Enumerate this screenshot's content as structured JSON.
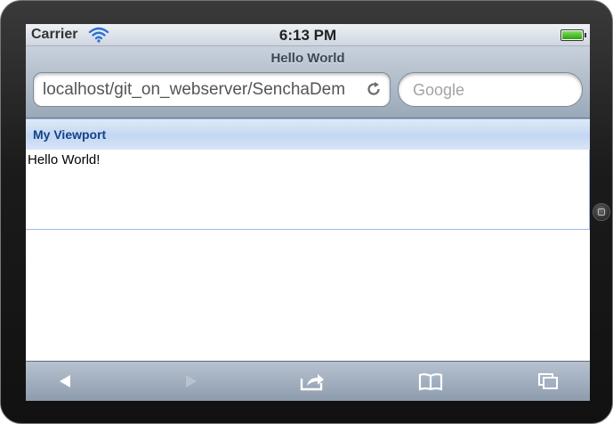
{
  "status_bar": {
    "carrier": "Carrier",
    "time": "6:13 PM",
    "wifi_icon": "wifi-icon",
    "battery_icon": "battery-icon"
  },
  "browser": {
    "page_title": "Hello World",
    "url": "localhost/git_on_webserver/SenchaDem",
    "search_placeholder": "Google",
    "reload_icon": "reload-icon"
  },
  "page": {
    "panel_title": "My Viewport",
    "panel_body": "Hello World!",
    "header_text_color": "#15428b",
    "panel_border_color": "#99bbe8"
  },
  "toolbar": {
    "items": [
      "back-arrow-icon",
      "forward-arrow-icon",
      "share-icon",
      "bookmarks-icon",
      "tabs-icon"
    ]
  }
}
